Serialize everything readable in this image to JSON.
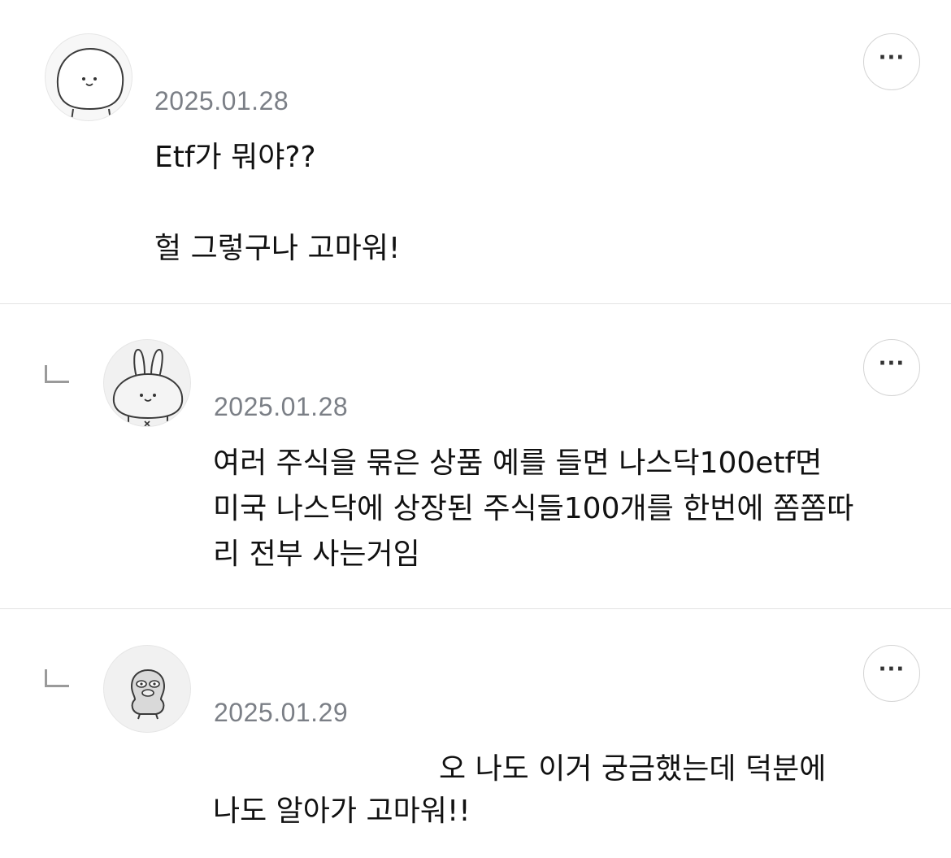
{
  "comments": [
    {
      "date": "2025.01.28",
      "body": "Etf가 뭐야??\n\n헐 그렇구나 고마워!",
      "more_label": "···",
      "avatar_icon": "white-blob-character-icon"
    },
    {
      "date": "2025.01.28",
      "body": "여러 주식을 묶은 상품 예를 들면 나스닥100etf면\n미국 나스닥에 상장된 주식들100개를 한번에 쫌쫌따\n리 전부 사는거임",
      "more_label": "···",
      "avatar_icon": "bunny-character-icon"
    },
    {
      "date": "2025.01.29",
      "body_line1": "오 나도 이거 궁금했는데 덕분에",
      "body_line2": "나도 알아가 고마워!!",
      "more_label": "···",
      "avatar_icon": "duck-character-icon"
    }
  ]
}
